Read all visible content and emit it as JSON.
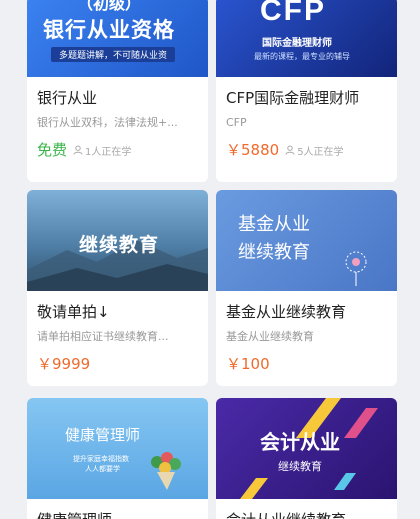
{
  "courses": [
    {
      "banner": {
        "line1": "（初级）",
        "line2": "银行从业资格",
        "tagline": "多题题讲解，不可随从业资",
        "bg": "#2f6fe0"
      },
      "title": "银行从业",
      "desc": "银行从业双科，法律法规+...",
      "price": "免费",
      "learners": "1人正在学"
    },
    {
      "banner": {
        "line1": "CFP",
        "line2": "国际金融理财师",
        "tagline": "最新的课程，最专业的辅导",
        "bg": "#1d3fb0"
      },
      "title": "CFP国际金融理财师",
      "desc": "CFP",
      "price": "￥5880",
      "learners": "5人正在学"
    },
    {
      "banner": {
        "line1": "继续教育",
        "bg": "#4d7fa8"
      },
      "title": "敬请单拍↓",
      "desc": "请单拍相应证书继续教育...",
      "price": "￥9999"
    },
    {
      "banner": {
        "line1": "基金从业",
        "line2": "继续教育",
        "bg": "#5f8ed6"
      },
      "title": "基金从业继续教育",
      "desc": "基金从业继续教育",
      "price": "￥100"
    },
    {
      "banner": {
        "line1": "健康管理师",
        "line2": "提升家庭幸福指数",
        "line3": "人人都要学",
        "bg": "#6fb6ea"
      },
      "title": "健康管理师"
    },
    {
      "banner": {
        "line1": "会计从业",
        "line2": "继续教育",
        "bg": "#3a1f8c"
      },
      "title": "会计从业继续教育"
    }
  ],
  "colors": {
    "price": "#f06a2c",
    "free": "#3bb54a"
  }
}
